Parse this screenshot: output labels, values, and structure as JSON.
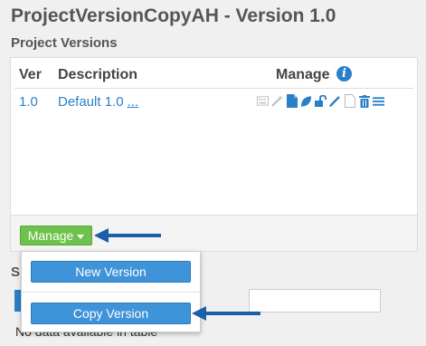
{
  "page": {
    "title": "ProjectVersionCopyAH - Version 1.0",
    "section_title": "Project Versions"
  },
  "table": {
    "headers": {
      "ver": "Ver",
      "description": "Description",
      "manage": "Manage"
    },
    "rows": [
      {
        "ver": "1.0",
        "description": "Default 1.0",
        "more": "..."
      }
    ],
    "row_action_icons": [
      "keyboard-icon",
      "magic-wand-icon",
      "document-icon",
      "leaf-icon",
      "unlock-icon",
      "pencil-icon",
      "blank-document-icon",
      "trash-icon",
      "list-icon"
    ]
  },
  "manage_menu": {
    "button_label": "Manage",
    "items": [
      "New Version",
      "Copy Version"
    ]
  },
  "background": {
    "section_partial": "S",
    "empty_text": "No data available in table"
  },
  "colors": {
    "accent_blue": "#2a7fc9",
    "button_green": "#6cc24a",
    "menu_button_blue": "#3f93d8",
    "arrow_blue": "#1a5fa8"
  }
}
